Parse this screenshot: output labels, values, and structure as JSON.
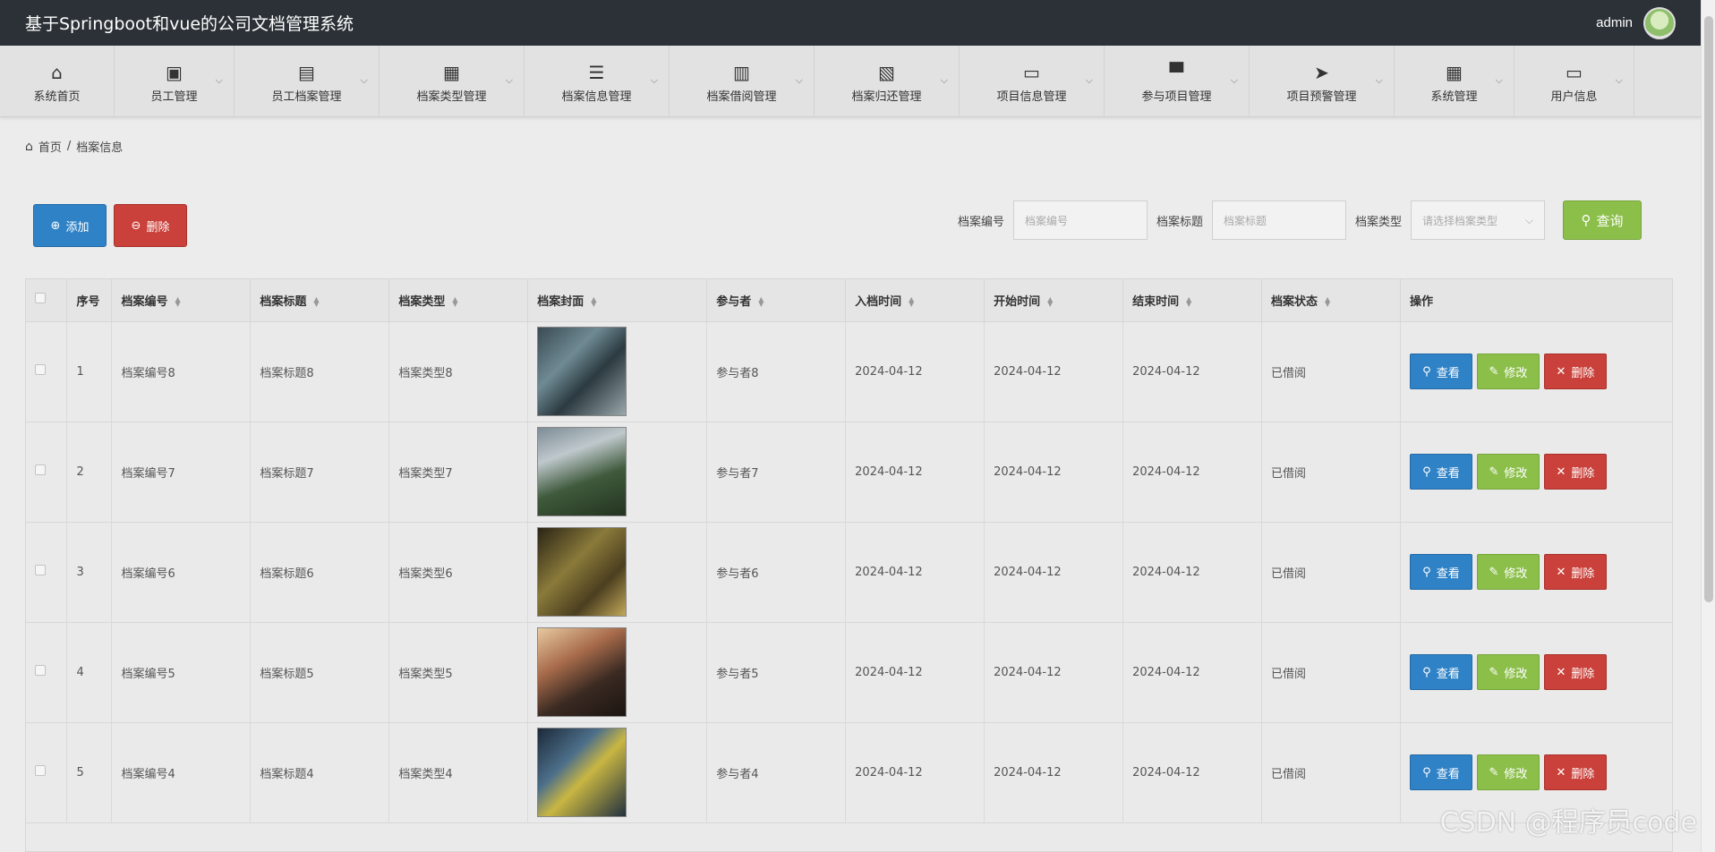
{
  "app": {
    "title": "基于Springboot和vue的公司文档管理系统",
    "username": "admin"
  },
  "nav": [
    {
      "label": "系统首页",
      "icon": "⌂",
      "name": "home",
      "dropdown": false
    },
    {
      "label": "员工管理",
      "icon": "▣",
      "name": "employee",
      "dropdown": true
    },
    {
      "label": "员工档案管理",
      "icon": "▤",
      "name": "employee-archive",
      "dropdown": true
    },
    {
      "label": "档案类型管理",
      "icon": "▦",
      "name": "archive-type",
      "dropdown": true
    },
    {
      "label": "档案信息管理",
      "icon": "☰",
      "name": "archive-info",
      "dropdown": true
    },
    {
      "label": "档案借阅管理",
      "icon": "▥",
      "name": "archive-borrow",
      "dropdown": true
    },
    {
      "label": "档案归还管理",
      "icon": "▧",
      "name": "archive-return",
      "dropdown": true
    },
    {
      "label": "项目信息管理",
      "icon": "▭",
      "name": "project-info",
      "dropdown": true
    },
    {
      "label": "参与项目管理",
      "icon": "▀",
      "name": "project-participation",
      "dropdown": true
    },
    {
      "label": "项目预警管理",
      "icon": "➤",
      "name": "project-warning",
      "dropdown": true
    },
    {
      "label": "系统管理",
      "icon": "▦",
      "name": "system",
      "dropdown": true
    },
    {
      "label": "用户信息",
      "icon": "▭",
      "name": "user-info",
      "dropdown": true
    }
  ],
  "breadcrumb": {
    "home": "首页",
    "separator": "/",
    "current": "档案信息"
  },
  "toolbar": {
    "add_label": "添加",
    "delete_label": "删除"
  },
  "search": {
    "code_label": "档案编号",
    "code_placeholder": "档案编号",
    "title_label": "档案标题",
    "title_placeholder": "档案标题",
    "type_label": "档案类型",
    "type_placeholder": "请选择档案类型",
    "query_label": "查询"
  },
  "table": {
    "columns": [
      "序号",
      "档案编号",
      "档案标题",
      "档案类型",
      "档案封面",
      "参与者",
      "入档时间",
      "开始时间",
      "结束时间",
      "档案状态",
      "操作"
    ],
    "actions": {
      "view": "查看",
      "edit": "修改",
      "delete": "删除"
    },
    "rows": [
      {
        "no": "1",
        "code": "档案编号8",
        "title": "档案标题8",
        "type": "档案类型8",
        "participant": "参与者8",
        "archived": "2024-04-12",
        "start": "2024-04-12",
        "end": "2024-04-12",
        "status": "已借阅"
      },
      {
        "no": "2",
        "code": "档案编号7",
        "title": "档案标题7",
        "type": "档案类型7",
        "participant": "参与者7",
        "archived": "2024-04-12",
        "start": "2024-04-12",
        "end": "2024-04-12",
        "status": "已借阅"
      },
      {
        "no": "3",
        "code": "档案编号6",
        "title": "档案标题6",
        "type": "档案类型6",
        "participant": "参与者6",
        "archived": "2024-04-12",
        "start": "2024-04-12",
        "end": "2024-04-12",
        "status": "已借阅"
      },
      {
        "no": "4",
        "code": "档案编号5",
        "title": "档案标题5",
        "type": "档案类型5",
        "participant": "参与者5",
        "archived": "2024-04-12",
        "start": "2024-04-12",
        "end": "2024-04-12",
        "status": "已借阅"
      },
      {
        "no": "5",
        "code": "档案编号4",
        "title": "档案标题4",
        "type": "档案类型4",
        "participant": "参与者4",
        "archived": "2024-04-12",
        "start": "2024-04-12",
        "end": "2024-04-12",
        "status": "已借阅"
      }
    ]
  },
  "watermark": "CSDN @程序员code",
  "colors": {
    "primary": "#2f82c6",
    "success": "#8cbf4a",
    "danger": "#c9413a",
    "header_bg": "#2b3136"
  }
}
